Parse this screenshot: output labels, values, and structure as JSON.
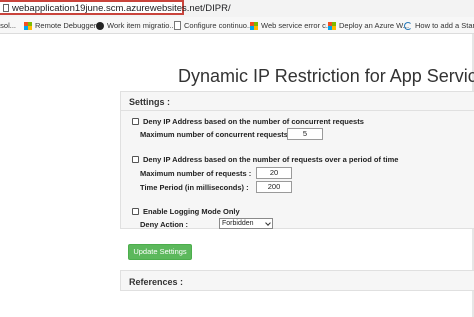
{
  "browser": {
    "url": "webapplication19june.scm.azurewebsites.net/DIPR/"
  },
  "bookmarks": [
    {
      "label": "esol...",
      "icon": "none"
    },
    {
      "label": "Remote Debugger...",
      "icon": "microsoft-icon"
    },
    {
      "label": "Work item migratio...",
      "icon": "github-icon"
    },
    {
      "label": "Configure continuo...",
      "icon": "document-icon"
    },
    {
      "label": "Web service error c...",
      "icon": "microsoft-icon"
    },
    {
      "label": "Deploy an Azure W...",
      "icon": "microsoft-icon"
    },
    {
      "label": "How to add a Start...",
      "icon": "sap-icon"
    }
  ],
  "page": {
    "title": "Dynamic IP Restriction for App Services"
  },
  "settings": {
    "heading": "Settings :",
    "deny_concurrent_label": "Deny IP Address based on the number of concurrent requests",
    "max_concurrent_label": "Maximum number of concurrent requests:",
    "max_concurrent_value": "5",
    "deny_period_label": "Deny IP Address based on the number of requests over a period of time",
    "max_requests_label": "Maximum number of requests :",
    "max_requests_value": "20",
    "time_period_label": "Time Period (in milliseconds) :",
    "time_period_value": "200",
    "logging_label": "Enable Logging Mode Only",
    "deny_action_label": "Deny Action :",
    "deny_action_value": "Forbidden",
    "update_button": "Update Settings"
  },
  "references": {
    "heading": "References :"
  },
  "colors": {
    "url_highlight": "#c9443c",
    "button_green": "#5cb85c"
  }
}
